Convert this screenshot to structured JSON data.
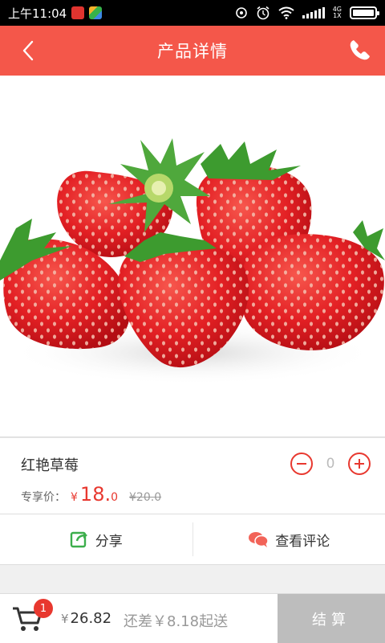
{
  "status_bar": {
    "time": "上午11:04",
    "network": "4G",
    "network_sub": "1X"
  },
  "header": {
    "title": "产品详情",
    "back_icon": "chevron-left-icon",
    "phone_icon": "phone-icon",
    "background_color": "#f4574a"
  },
  "product": {
    "image": "strawberries",
    "name": "红艳草莓",
    "price_label": "专享价：",
    "currency": "¥",
    "price_int": "18.",
    "price_dec": "0",
    "old_price": "¥20.0",
    "quantity": "0",
    "accent_color": "#e8382f"
  },
  "actions": {
    "share_label": "分享",
    "share_icon": "share-icon",
    "reviews_label": "查看评论",
    "reviews_icon": "comment-icon"
  },
  "bottom_bar": {
    "cart_icon": "cart-icon",
    "cart_count": "1",
    "currency": "¥",
    "total": "26.82",
    "need_more": "还差￥8.18起送",
    "checkout_label": "结算"
  }
}
